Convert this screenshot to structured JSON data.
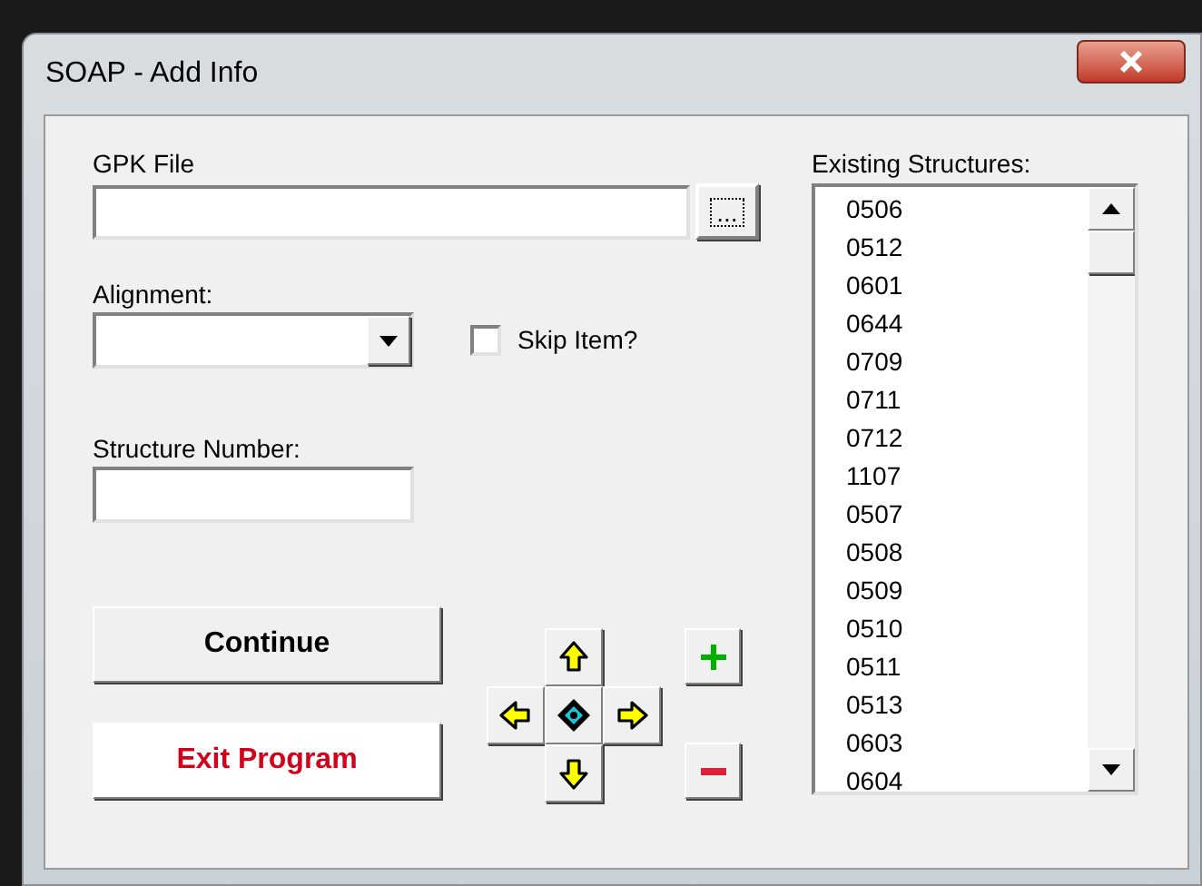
{
  "window": {
    "title": "SOAP - Add Info"
  },
  "gpk_file": {
    "label": "GPK File",
    "browse_label": "..."
  },
  "alignment": {
    "label": "Alignment:"
  },
  "skip_item": {
    "label": "Skip Item?",
    "checked": false
  },
  "structure_number": {
    "label": "Structure Number:"
  },
  "buttons": [
    {
      "label": "Continue",
      "kind": "primary"
    },
    {
      "label": "Exit Program",
      "kind": "exit"
    }
  ],
  "existing_structures": {
    "label": "Existing Structures:",
    "items": [
      "0506",
      "0512",
      "0601",
      "0644",
      "0709",
      "0711",
      "0712",
      "1107",
      "0507",
      "0508",
      "0509",
      "0510",
      "0511",
      "0513",
      "0603",
      "0604"
    ]
  }
}
